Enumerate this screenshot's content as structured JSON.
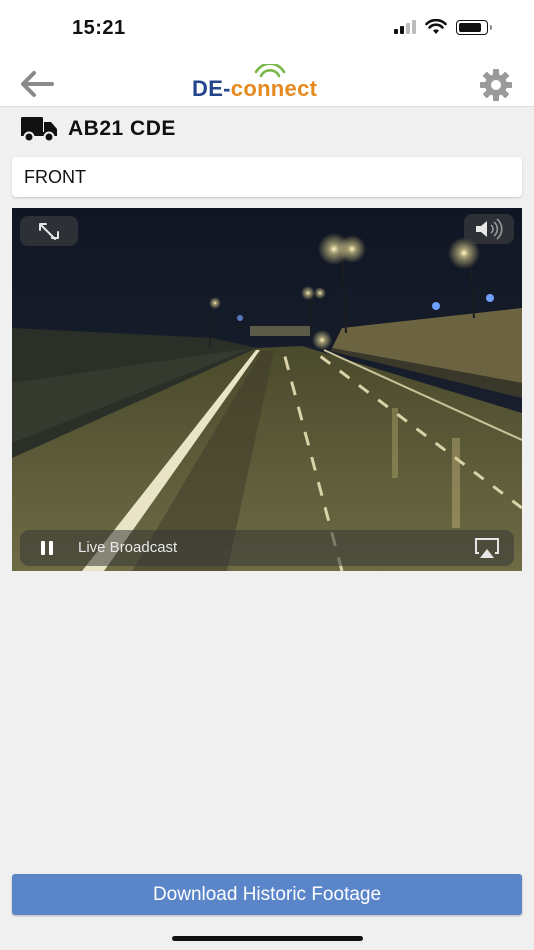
{
  "status_bar": {
    "time": "15:21"
  },
  "nav": {
    "logo_prefix": "DE-",
    "logo_brand": "connect",
    "back_icon": "back-arrow-icon",
    "settings_icon": "gear-icon"
  },
  "vehicle": {
    "registration": "AB21 CDE",
    "icon": "truck-icon"
  },
  "camera": {
    "selected": "FRONT"
  },
  "player": {
    "status_label": "Live Broadcast",
    "state": "playing"
  },
  "actions": {
    "download_label": "Download Historic Footage"
  },
  "colors": {
    "brand_blue": "#23458c",
    "brand_orange": "#e58a1f",
    "button_blue": "#5a86c9",
    "background": "#f0f0f0"
  }
}
